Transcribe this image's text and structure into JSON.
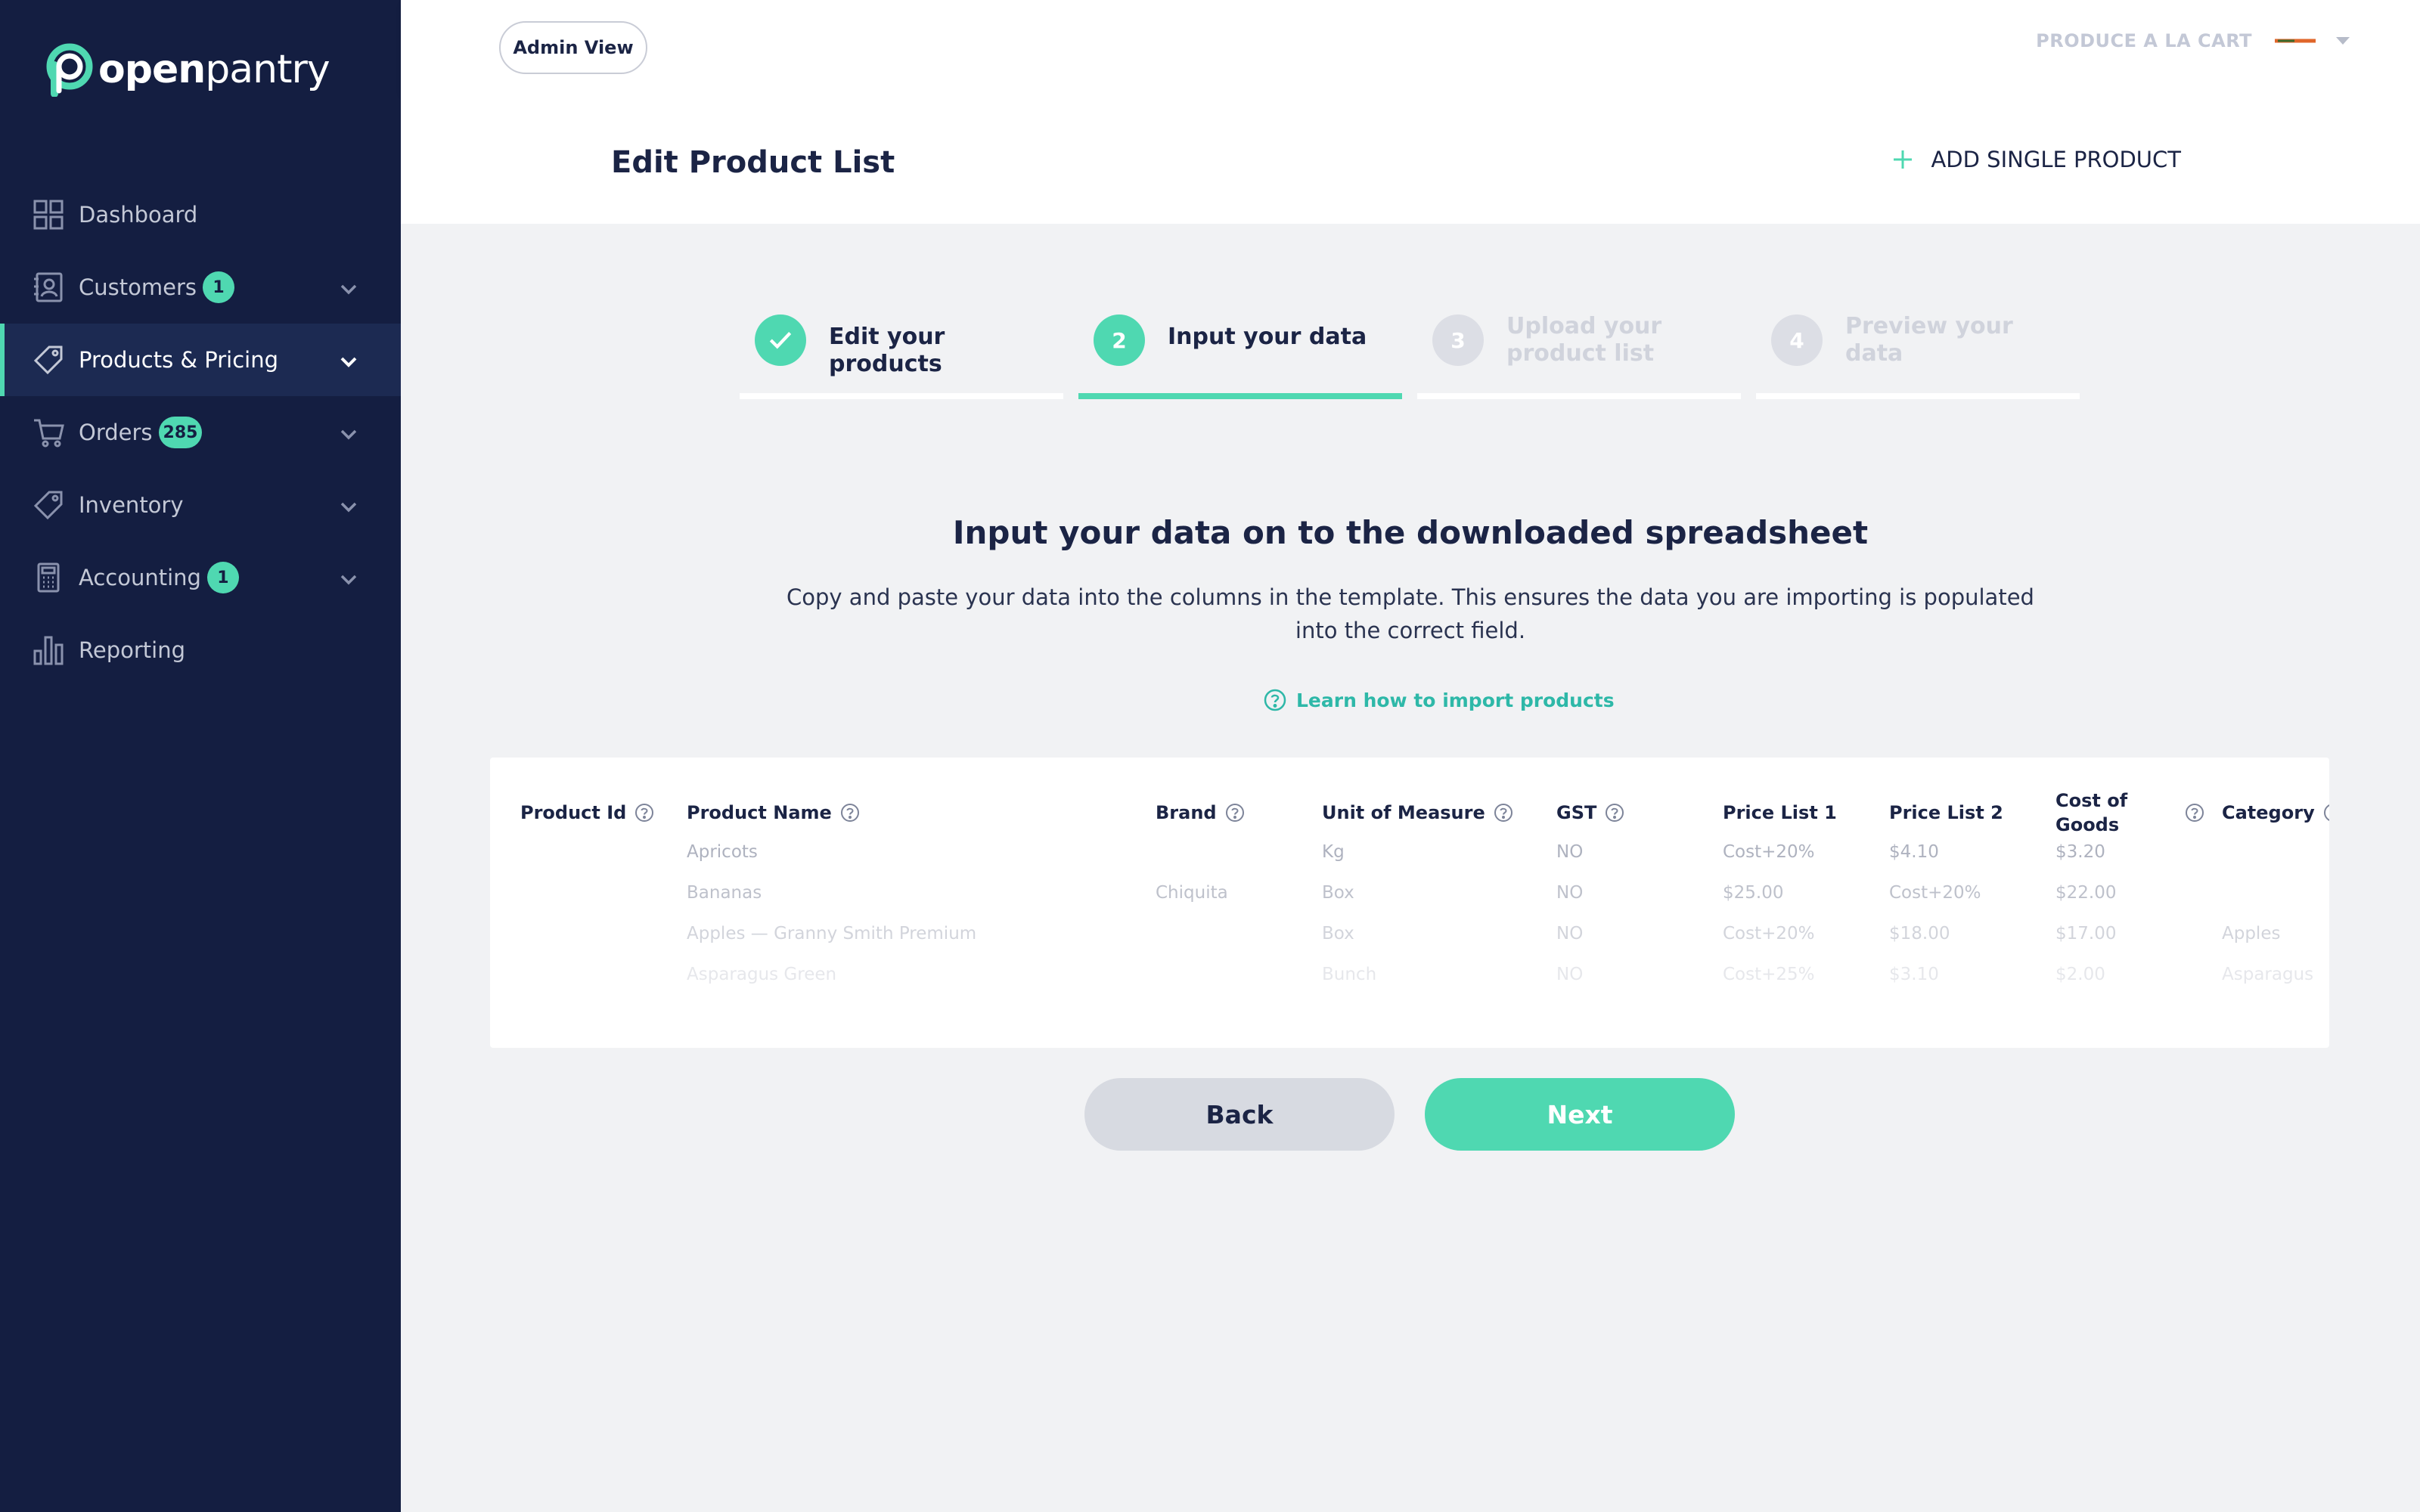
{
  "app": {
    "logo_text_bold": "open",
    "logo_text_light": "pantry"
  },
  "sidebar": {
    "items": [
      {
        "label": "Dashboard",
        "icon": "grid-icon",
        "badge": null,
        "expandable": false,
        "active": false
      },
      {
        "label": "Customers",
        "icon": "contact-book-icon",
        "badge": "1",
        "expandable": true,
        "active": false
      },
      {
        "label": "Products & Pricing",
        "icon": "price-tag-icon",
        "badge": null,
        "expandable": true,
        "active": true
      },
      {
        "label": "Orders",
        "icon": "shopping-cart-icon",
        "badge": "285",
        "expandable": true,
        "active": false
      },
      {
        "label": "Inventory",
        "icon": "tag-icon",
        "badge": null,
        "expandable": true,
        "active": false
      },
      {
        "label": "Accounting",
        "icon": "calculator-icon",
        "badge": "1",
        "expandable": true,
        "active": false
      },
      {
        "label": "Reporting",
        "icon": "bar-chart-icon",
        "badge": null,
        "expandable": false,
        "active": false
      }
    ]
  },
  "topbar": {
    "admin_button": "Admin View",
    "account_name": "PRODUCE A LA CART"
  },
  "page": {
    "title": "Edit Product List",
    "add_single_product": "ADD SINGLE PRODUCT"
  },
  "stepper": {
    "steps": [
      {
        "number": "1",
        "label": "Edit your products",
        "state": "done"
      },
      {
        "number": "2",
        "label": "Input your data",
        "state": "current"
      },
      {
        "number": "3",
        "label": "Upload your product list",
        "state": "todo"
      },
      {
        "number": "4",
        "label": "Preview your data",
        "state": "todo"
      }
    ]
  },
  "content": {
    "heading": "Input your data on to the downloaded spreadsheet",
    "description": "Copy and paste your data into the columns in the template. This ensures the data you are importing is populated into the correct field.",
    "learn_link": "Learn how to import products"
  },
  "table": {
    "columns": [
      "Product Id",
      "Product Name",
      "Brand",
      "Unit of Measure",
      "GST",
      "Price List 1",
      "Price List 2",
      "Cost of Goods",
      "Category"
    ],
    "rows": [
      [
        "",
        "Apricots",
        "",
        "Kg",
        "NO",
        "Cost+20%",
        "$4.10",
        "$3.20",
        ""
      ],
      [
        "",
        "Bananas",
        "Chiquita",
        "Box",
        "NO",
        "$25.00",
        "Cost+20%",
        "$22.00",
        ""
      ],
      [
        "",
        "Apples — Granny Smith Premium",
        "",
        "Box",
        "NO",
        "Cost+20%",
        "$18.00",
        "$17.00",
        "Apples"
      ],
      [
        "",
        "Asparagus Green",
        "",
        "Bunch",
        "NO",
        "Cost+25%",
        "$3.10",
        "$2.00",
        "Asparagus"
      ]
    ]
  },
  "buttons": {
    "back": "Back",
    "next": "Next"
  },
  "colors": {
    "sidebar_bg": "#141e41",
    "accent": "#4fd8b1",
    "link": "#2eb8a8",
    "page_bg": "#f1f2f4"
  }
}
